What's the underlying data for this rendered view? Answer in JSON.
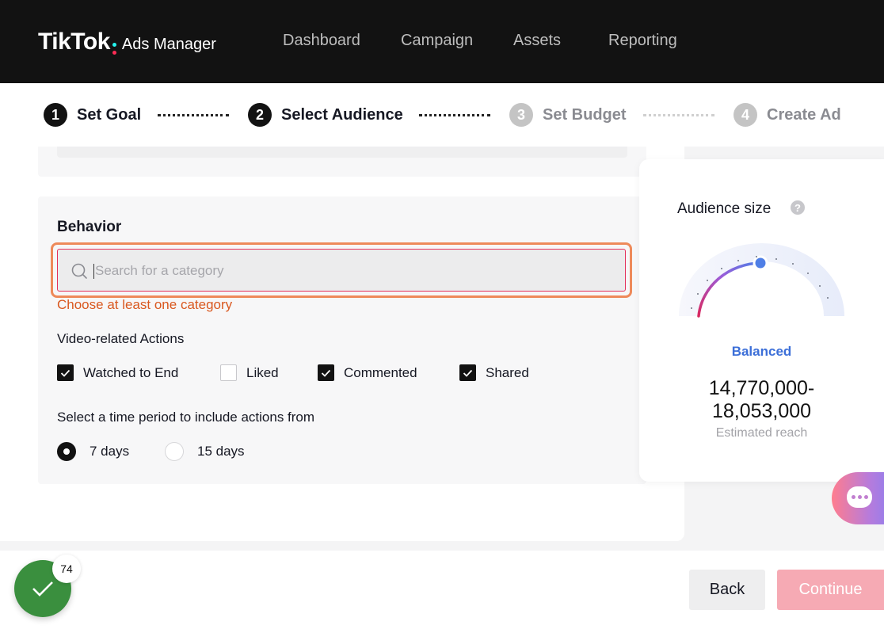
{
  "header": {
    "brand": "TikTok",
    "product": "Ads Manager",
    "nav": [
      "Dashboard",
      "Campaign",
      "Assets",
      "Reporting"
    ]
  },
  "steps": [
    {
      "num": "1",
      "label": "Set Goal"
    },
    {
      "num": "2",
      "label": "Select Audience"
    },
    {
      "num": "3",
      "label": "Set Budget"
    },
    {
      "num": "4",
      "label": "Create Ad"
    }
  ],
  "behavior": {
    "title": "Behavior",
    "search_placeholder": "Search for a category",
    "search_value": "",
    "error": "Choose at least one category",
    "actions_label": "Video-related Actions",
    "actions": [
      {
        "label": "Watched to End",
        "checked": true
      },
      {
        "label": "Liked",
        "checked": false
      },
      {
        "label": "Commented",
        "checked": true
      },
      {
        "label": "Shared",
        "checked": true
      }
    ],
    "period_label": "Select a time period to include actions from",
    "periods": [
      {
        "label": "7 days",
        "selected": true
      },
      {
        "label": "15 days",
        "selected": false
      }
    ]
  },
  "audience": {
    "title": "Audience size",
    "help": "?",
    "status": "Balanced",
    "reach_line1": "14,770,000-",
    "reach_line2": "18,053,000",
    "reach_caption": "Estimated reach"
  },
  "footer": {
    "back": "Back",
    "continue": "Continue",
    "badge": "74"
  },
  "colors": {
    "accent_pink": "#fe2c55",
    "error_orange": "#d9581f",
    "balanced_blue": "#3c6fd8",
    "continue_disabled": "#f6aab4"
  }
}
